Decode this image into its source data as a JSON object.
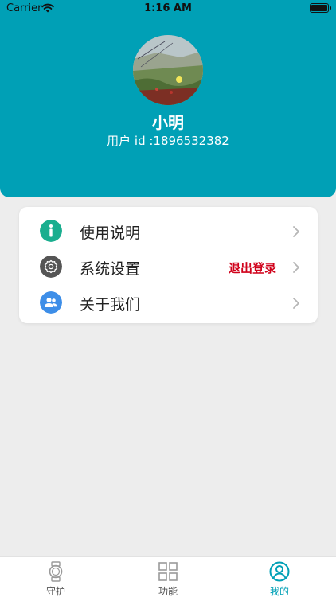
{
  "status_bar": {
    "carrier": "Carrier",
    "time": "1:16 AM"
  },
  "profile": {
    "name": "小明",
    "user_id": "用户 id :1896532382"
  },
  "menu": {
    "items": [
      {
        "label": "使用说明",
        "icon": "info-icon",
        "icon_color": "#1aae8f"
      },
      {
        "label": "系统设置",
        "icon": "gear-icon",
        "icon_color": "#555555",
        "extra": "退出登录"
      },
      {
        "label": "关于我们",
        "icon": "users-icon",
        "icon_color": "#3d8ee8"
      }
    ]
  },
  "tabbar": {
    "tabs": [
      {
        "label": "守护",
        "icon": "watch-icon",
        "active": false
      },
      {
        "label": "功能",
        "icon": "grid-icon",
        "active": false
      },
      {
        "label": "我的",
        "icon": "profile-icon",
        "active": true
      }
    ]
  },
  "colors": {
    "accent": "#00a0b6",
    "danger": "#d0021b",
    "background": "#ededed"
  }
}
